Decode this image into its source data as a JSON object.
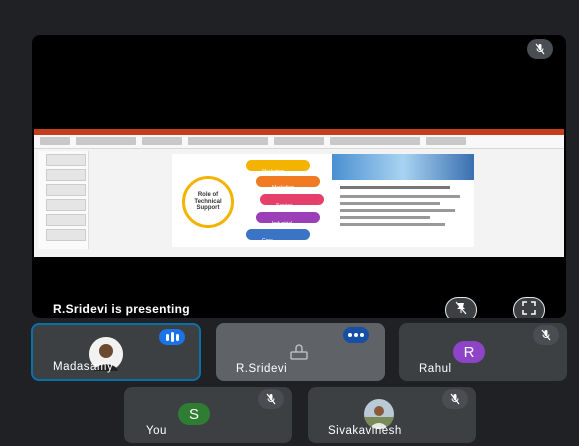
{
  "presentation": {
    "presenting_label": "R.Sridevi is presenting",
    "slide_title": "Role of Technical Support",
    "slide_items": [
      "Marketing",
      "Marketing",
      "Service",
      "Industrial",
      "Core"
    ]
  },
  "participants": [
    {
      "name": "Madasamy",
      "status": "speaking"
    },
    {
      "name": "R.Sridevi",
      "status": "speaking"
    },
    {
      "name": "Rahul",
      "initial": "R",
      "avatar_color": "#8e44c6",
      "status": "muted"
    },
    {
      "name": "You",
      "initial": "S",
      "avatar_color": "#2e7d32",
      "status": "muted"
    },
    {
      "name": "Sivakavinesh",
      "status": "muted"
    }
  ],
  "icons": {
    "muted": "mic-off-icon",
    "pin": "pin-off-icon",
    "fullscreen": "fullscreen-icon"
  },
  "colors": {
    "background": "#202124",
    "tile": "#3c4043",
    "active_border": "#0b6fa8",
    "speaking": "#8ab4f8"
  }
}
